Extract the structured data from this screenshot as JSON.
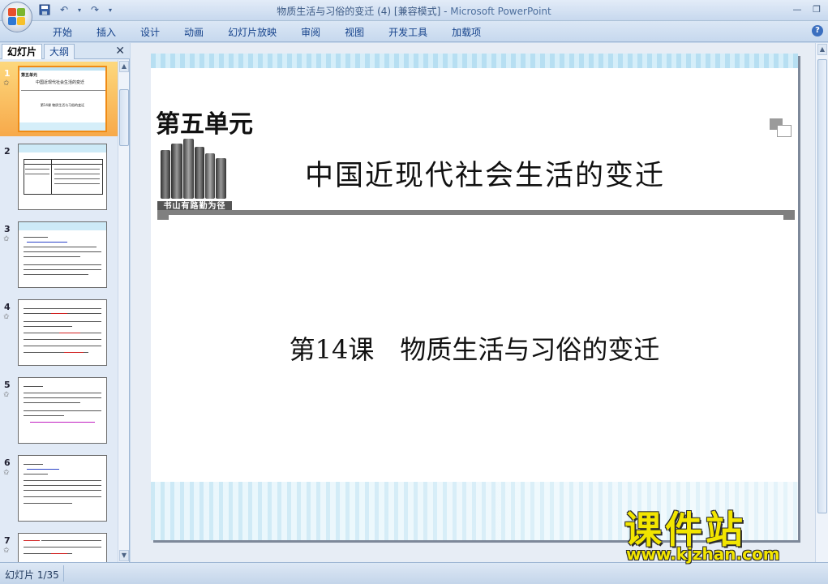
{
  "window": {
    "title_doc": "物质生活与习俗的变迁 (4) [兼容模式]",
    "title_sep": " - ",
    "title_app": "Microsoft PowerPoint"
  },
  "ribbon": {
    "tabs": [
      "开始",
      "插入",
      "设计",
      "动画",
      "幻灯片放映",
      "审阅",
      "视图",
      "开发工具",
      "加载项"
    ]
  },
  "panel": {
    "tab_slides": "幻灯片",
    "tab_outline": "大纲",
    "thumbnails": [
      {
        "num": "1",
        "selected": true
      },
      {
        "num": "2",
        "selected": false
      },
      {
        "num": "3",
        "selected": false
      },
      {
        "num": "4",
        "selected": false
      },
      {
        "num": "5",
        "selected": false
      },
      {
        "num": "6",
        "selected": false
      },
      {
        "num": "7",
        "selected": false
      }
    ],
    "thumb1": {
      "unit": "第五单元",
      "title": "中国近现代社会生活的变迁",
      "lesson": "第14课 物质生活与习俗的变迁"
    }
  },
  "slide": {
    "unit_title": "第五单元",
    "books_caption": "书山有路勤为径",
    "main_title": "中国近现代社会生活的变迁",
    "lesson_title": "第14课　物质生活与习俗的变迁"
  },
  "status": {
    "slide_counter": "幻灯片 1/35"
  },
  "watermark": {
    "brand": "课件站",
    "url": "www.kjzhan.com"
  },
  "colors": {
    "selected_thumb": "#f7a94a",
    "watermark_yellow": "#f2e500"
  }
}
